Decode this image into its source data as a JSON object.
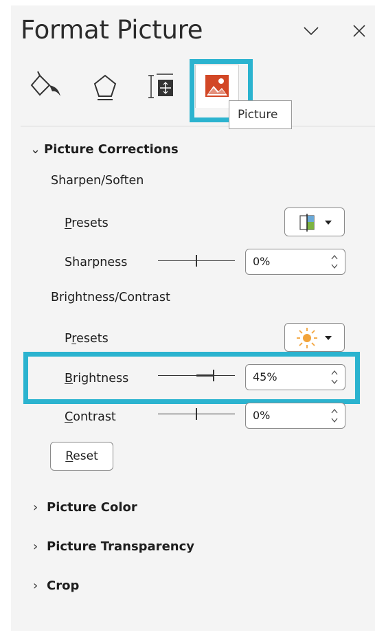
{
  "panel": {
    "title": "Format Picture",
    "minimize_icon": "chevron-down-icon",
    "close_icon": "close-icon"
  },
  "tabs": [
    {
      "name": "Fill & Line",
      "icon": "paint-bucket-icon"
    },
    {
      "name": "Effects",
      "icon": "pentagon-icon"
    },
    {
      "name": "Size & Properties",
      "icon": "size-properties-icon"
    },
    {
      "name": "Picture",
      "icon": "picture-icon",
      "selected": true
    }
  ],
  "tooltip": "Picture",
  "sections": {
    "corrections": {
      "title": "Picture Corrections",
      "expanded": true,
      "sharpen_soften": {
        "heading": "Sharpen/Soften",
        "presets_label": "Presets",
        "sharpness_label": "Sharpness",
        "sharpness_value": "0%",
        "sharpness_level": 0.5
      },
      "brightness_contrast": {
        "heading": "Brightness/Contrast",
        "presets_label": "Presets",
        "brightness_label": "Brightness",
        "brightness_value": "45%",
        "brightness_level": 0.725,
        "contrast_label": "Contrast",
        "contrast_value": "0%",
        "contrast_level": 0.5
      },
      "reset_label": "Reset"
    },
    "color": {
      "title": "Picture Color",
      "expanded": false
    },
    "transparency": {
      "title": "Picture Transparency",
      "expanded": false
    },
    "crop": {
      "title": "Crop",
      "expanded": false
    }
  },
  "colors": {
    "highlight": "#2bb3cf",
    "picture_icon": "#d24726",
    "sun_icon": "#f2a33a"
  }
}
